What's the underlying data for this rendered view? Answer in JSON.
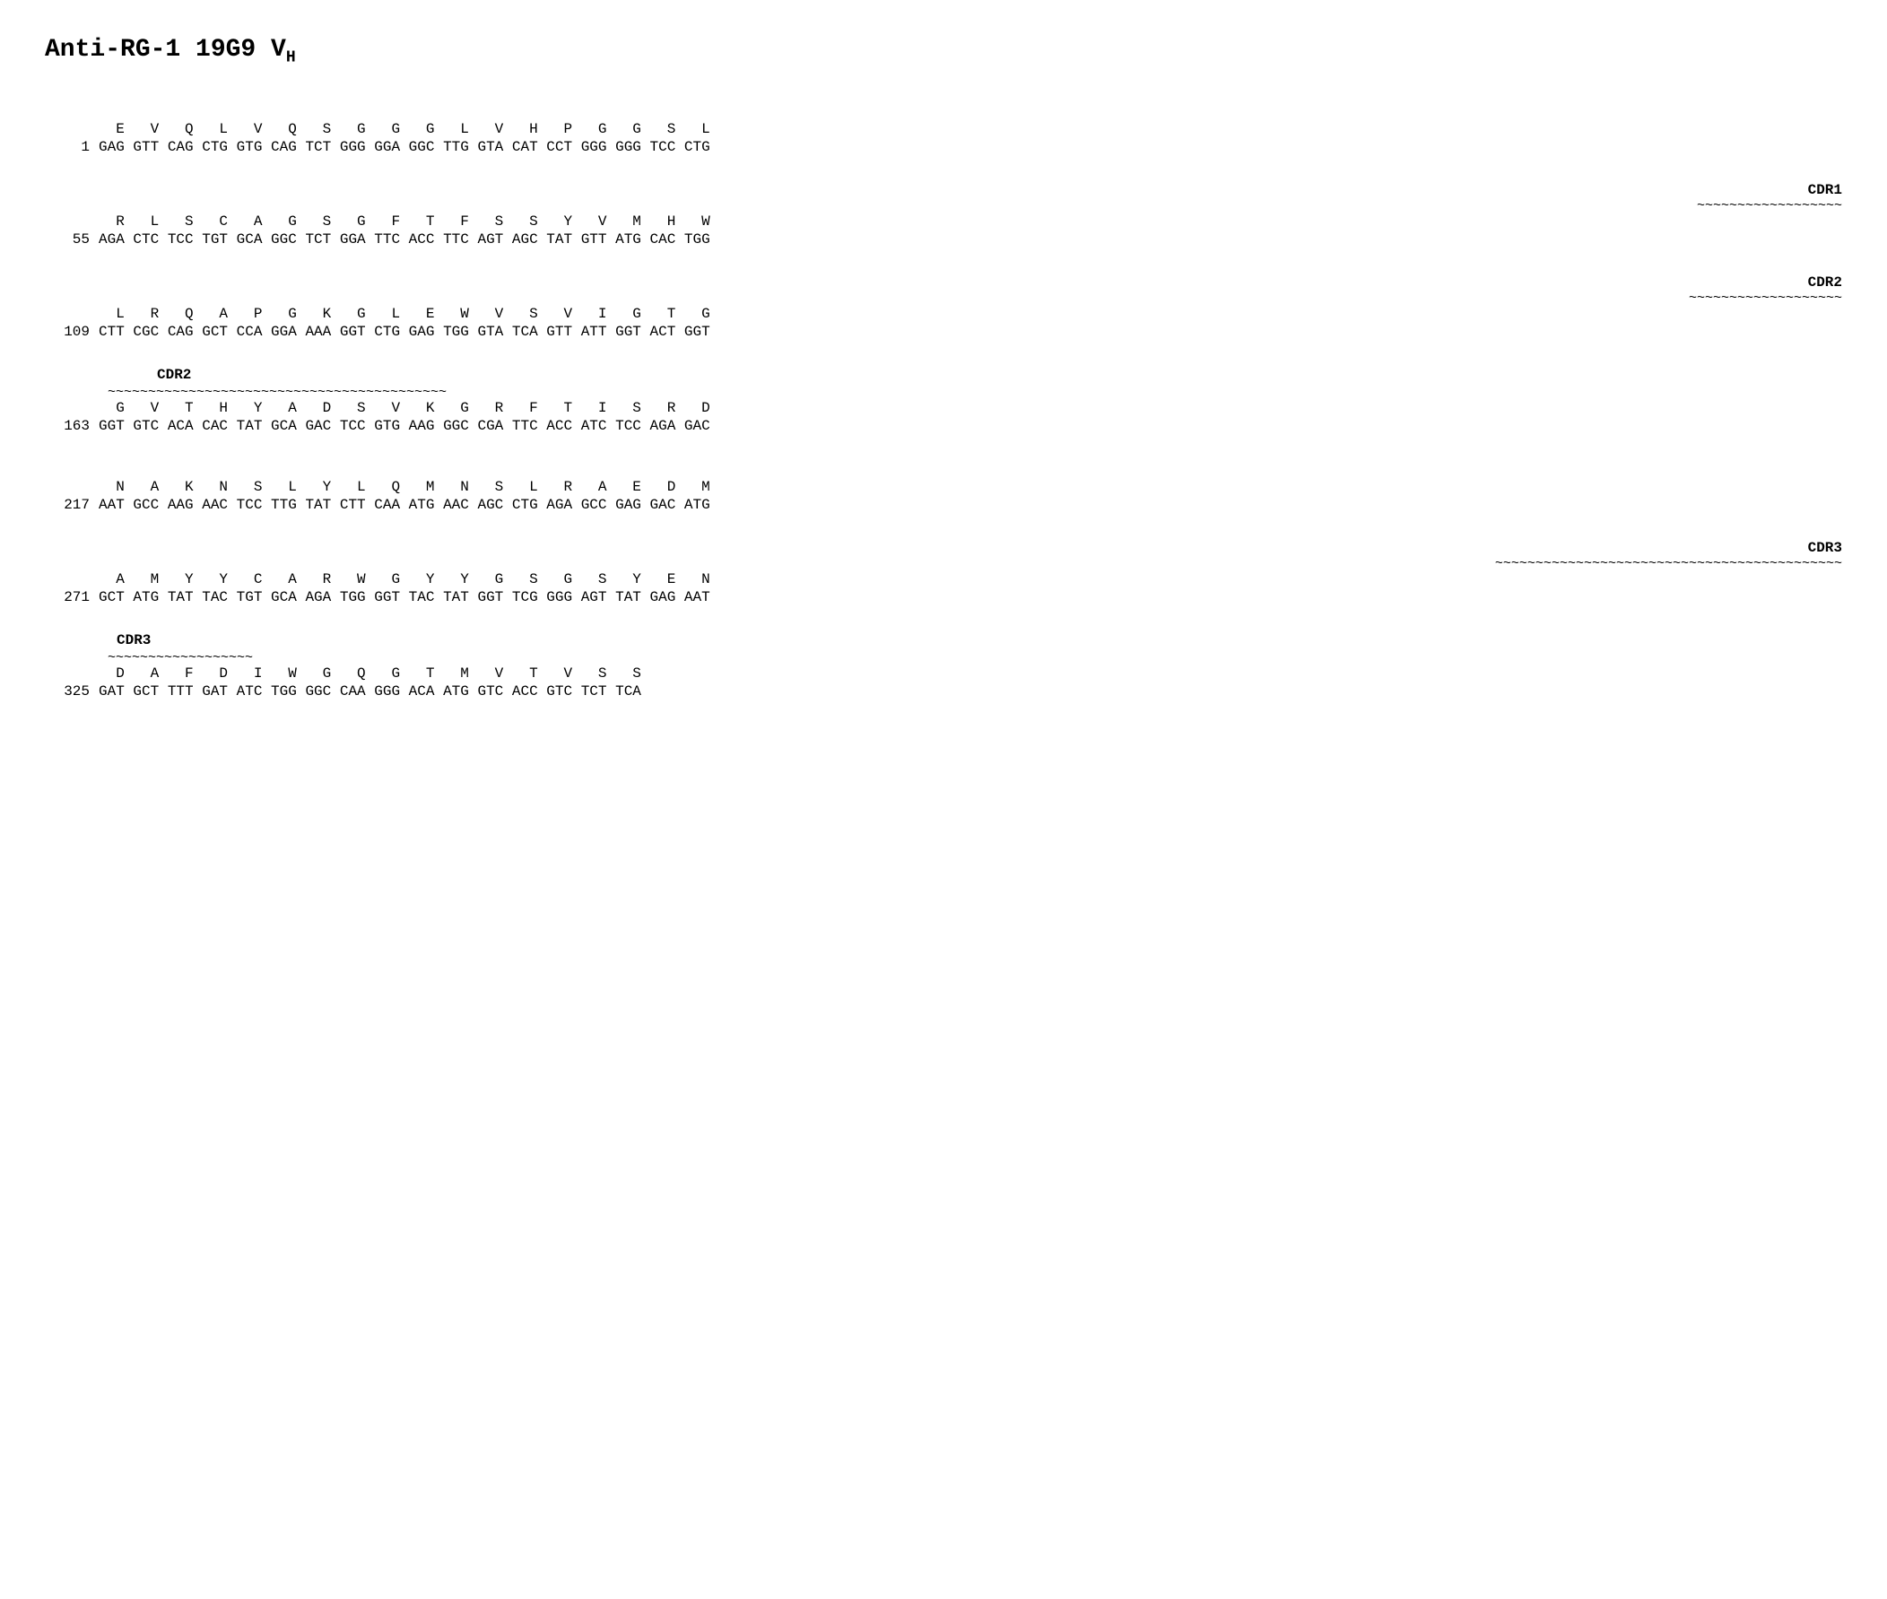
{
  "title": {
    "text": "Anti-RG-1 19G9 V",
    "subscript": "H"
  },
  "blocks": [
    {
      "id": "block1",
      "lineNumber": "1",
      "aminoAcids": "  E   V   Q   L   V   Q   S   G   G   G   L   V   H   P   G   G   S   L",
      "codons": "GAG GTT CAG CTG GTG CAG TCT GGG GGA GGC TTG GTA CAT CCT GGG GGG TCC CTG",
      "preAnnotationLabel": "",
      "preAnnotationTilde": "",
      "postAnnotationLabel": "CDR1",
      "postAnnotationTilde": "                                              ~~~~~~~~~~~~~~~~~~",
      "tildeAlign": "right"
    },
    {
      "id": "block2",
      "lineNumber": "55",
      "aminoAcids": "  R   L   S   C   A   G   S   G   F   T   F   S   S   Y   V   M   H   W",
      "codons": "AGA CTC TCC TGT GCA GGC TCT GGA TTC ACC TTC AGT AGC TAT GTT ATG CAC TGG",
      "preAnnotationLabel": "",
      "preAnnotationTilde": "",
      "postAnnotationLabel": "CDR2",
      "postAnnotationTilde": "                                                ~~~~~~~~~~~~~~~~~~~",
      "tildeAlign": "right"
    },
    {
      "id": "block3",
      "lineNumber": "109",
      "aminoAcids": "  L   R   Q   A   P   G   K   G   L   E   W   V   S   V   I   G   T   G",
      "codons": "CTT CGC CAG GCT CCA GGA AAA GGT CTG GAG TGG GTA TCA GTT ATT GGT ACT GGT",
      "preAnnotationLabel": "CDR2",
      "preAnnotationTilde": "~~~~~~~~~~~~~~~~~~~~~~~~~~~~~~~~~~~~~~~~~~",
      "postAnnotationLabel": "",
      "postAnnotationTilde": "",
      "tildeAlign": "left"
    },
    {
      "id": "block4",
      "lineNumber": "163",
      "aminoAcids": "  G   V   T   H   Y   A   D   S   V   K   G   R   F   T   I   S   R   D",
      "codons": "GGT GTC ACA CAC TAT GCA GAC TCC GTG AAG GGC CGA TTC ACC ATC TCC AGA GAC",
      "preAnnotationLabel": "",
      "preAnnotationTilde": "",
      "postAnnotationLabel": "",
      "postAnnotationTilde": "",
      "tildeAlign": ""
    },
    {
      "id": "block5",
      "lineNumber": "217",
      "aminoAcids": "  N   A   K   N   S   L   Y   L   Q   M   N   S   L   R   A   E   D   M",
      "codons": "AAT GCC AAG AAC TCC TTG TAT CTT CAA ATG AAC AGC CTG AGA GCC GAG GAC ATG",
      "preAnnotationLabel": "",
      "preAnnotationTilde": "",
      "postAnnotationLabel": "CDR3",
      "postAnnotationTilde": "                                                ~~~~~~~~~~~~~~~~~~~~~~~~~~~~~~~~~~~~~~~~~~~",
      "tildeAlign": "right"
    },
    {
      "id": "block6",
      "lineNumber": "271",
      "aminoAcids": "  A   M   Y   Y   C   A   R   W   G   Y   Y   G   S   G   S   Y   E   N",
      "codons": "GCT ATG TAT TAC TGT GCA AGA TGG GGT TAC TAT GGT TCG GGG AGT TAT GAG AAT",
      "preAnnotationLabel": "CDR3",
      "preAnnotationTilde": "~~~~~~~~~~~~~~~~~~",
      "postAnnotationLabel": "",
      "postAnnotationTilde": "",
      "tildeAlign": "left"
    },
    {
      "id": "block7",
      "lineNumber": "325",
      "aminoAcids": "  D   A   F   D   I   W   G   Q   G   T   M   V   T   V   S   S",
      "codons": "GAT GCT TTT GAT ATC TGG GGC CAA GGG ACA ATG GTC ACC GTC TCT TCA",
      "preAnnotationLabel": "",
      "preAnnotationTilde": "",
      "postAnnotationLabel": "",
      "postAnnotationTilde": "",
      "tildeAlign": ""
    }
  ]
}
